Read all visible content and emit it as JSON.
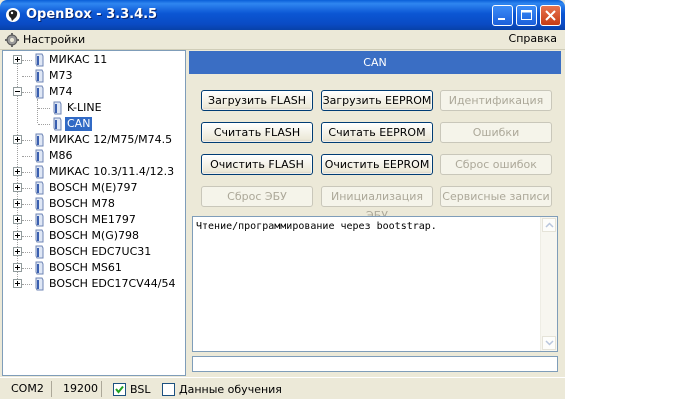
{
  "window": {
    "title": "OpenBox - 3.3.4.5"
  },
  "menu": {
    "settings": "Настройки",
    "help": "Справка"
  },
  "tree": {
    "nodes": [
      {
        "label": "МИКАС 11",
        "expander": "plus"
      },
      {
        "label": "M73",
        "expander": "none"
      },
      {
        "label": "M74",
        "expander": "minus"
      },
      {
        "label": "K-LINE",
        "expander": "none"
      },
      {
        "label": "CAN",
        "expander": "none",
        "selected": true
      },
      {
        "label": "МИКАС 12/M75/M74.5",
        "expander": "plus"
      },
      {
        "label": "M86",
        "expander": "none"
      },
      {
        "label": "МИКАС 10.3/11.4/12.3",
        "expander": "plus"
      },
      {
        "label": "BOSCH M(E)797",
        "expander": "plus"
      },
      {
        "label": "BOSCH M78",
        "expander": "plus"
      },
      {
        "label": "BOSCH ME1797",
        "expander": "plus"
      },
      {
        "label": "BOSCH M(G)798",
        "expander": "plus"
      },
      {
        "label": "BOSCH EDC7UC31",
        "expander": "plus"
      },
      {
        "label": "BOSCH MS61",
        "expander": "plus"
      },
      {
        "label": "BOSCH EDC17CV44/54",
        "expander": "plus"
      }
    ]
  },
  "panel": {
    "header": "CAN",
    "buttons": {
      "load_flash": "Загрузить FLASH",
      "load_eeprom": "Загрузить EEPROM",
      "identification": "Идентификация",
      "read_flash": "Считать FLASH",
      "read_eeprom": "Считать EEPROM",
      "errors": "Ошибки",
      "clear_flash": "Очистить FLASH",
      "clear_eeprom": "Очистить EEPROM",
      "reset_errors": "Сброс ошибок",
      "reset_ecu": "Сброс ЭБУ",
      "init_ecu": "Инициализация ЭБУ",
      "service_records": "Сервисные записи"
    },
    "log": {
      "text": "Чтение/программирование через bootstrap."
    }
  },
  "status": {
    "port": "COM2",
    "baud": "19200",
    "bsl": {
      "label": "BSL",
      "checked": true
    },
    "training": {
      "label": "Данные обучения",
      "checked": false
    }
  },
  "colors": {
    "titlebar": "#0a4bc4",
    "panel_header": "#3a6ec4",
    "selection": "#316ac5",
    "window_bg": "#ece9d8"
  }
}
